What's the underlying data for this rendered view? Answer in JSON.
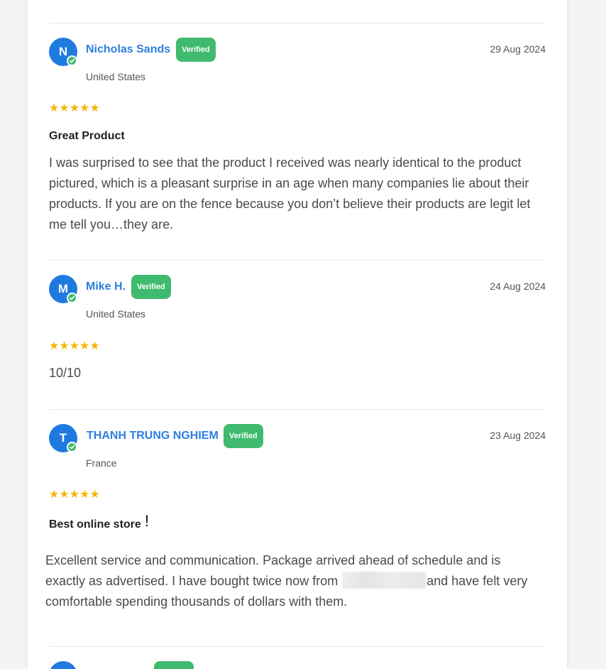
{
  "reviews": [
    {
      "initial": "N",
      "name": "Nicholas Sands",
      "badge": "Verified",
      "date": "29 Aug 2024",
      "country": "United States",
      "stars": "★★★★★",
      "rating": 5,
      "title": "Great Product",
      "body": "I was surprised to see that the product I received was nearly identical to the product pictured, which is a pleasant surprise in an age when many companies lie about their products. If you are on the fence because you don’t believe their products are legit let me tell you…they are."
    },
    {
      "initial": "M",
      "name": "Mike H.",
      "badge": "Verified",
      "date": "24 Aug 2024",
      "country": "United States",
      "stars": "★★★★★",
      "rating": 5,
      "body": "10/10"
    },
    {
      "initial": "T",
      "name": "THANH TRUNG NGHIEM",
      "badge": "Verified",
      "date": "23 Aug 2024",
      "country": "France",
      "stars": "★★★★★",
      "rating": 5,
      "title": "Best online store",
      "title_mark": "!",
      "body_part1": "Excellent service and communication. Package arrived ahead of schedule and is exactly as advertised. I have bought twice now from",
      "body_part2": "and have felt very comfortable spending thousands of dollars with them."
    }
  ],
  "colors": {
    "avatar": "#1f7ae0",
    "name": "#2d7fe0",
    "verified": "#3fba6e",
    "stars": "#f2b807"
  },
  "icons": {
    "verified_check": "check-circle-icon"
  }
}
